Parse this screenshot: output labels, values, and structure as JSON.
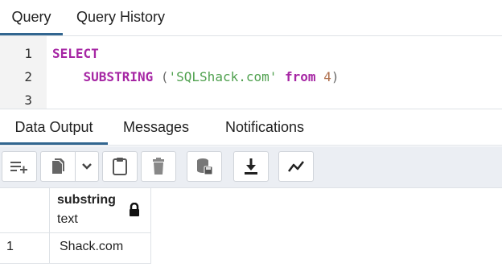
{
  "top_tabs": {
    "query": "Query",
    "history": "Query History"
  },
  "editor": {
    "line_numbers": [
      "1",
      "2",
      "3"
    ],
    "line1": {
      "keyword": "SELECT"
    },
    "line2": {
      "indent": "    ",
      "function": "SUBSTRING",
      "space": " ",
      "open_paren": "(",
      "string": "'SQLShack.com'",
      "from_kw": "from",
      "number": "4",
      "close_paren": ")"
    }
  },
  "bottom_tabs": {
    "data_output": "Data Output",
    "messages": "Messages",
    "notifications": "Notifications"
  },
  "toolbar": {
    "buttons": [
      {
        "name": "add-row-icon"
      },
      {
        "name": "copy-icon"
      },
      {
        "name": "chevron-down-icon"
      },
      {
        "name": "paste-icon"
      },
      {
        "name": "delete-icon"
      },
      {
        "name": "save-data-icon"
      },
      {
        "name": "download-icon"
      },
      {
        "name": "graph-visualiser-icon"
      }
    ]
  },
  "result": {
    "column_name": "substring",
    "column_type": "text",
    "rows": [
      {
        "row_number": "1",
        "value": "Shack.com"
      }
    ]
  },
  "colors": {
    "accent": "#326690",
    "keyword": "#a626a4",
    "string": "#50a14f",
    "number": "#b0704e",
    "toolbar_bg": "#ebeef3"
  }
}
